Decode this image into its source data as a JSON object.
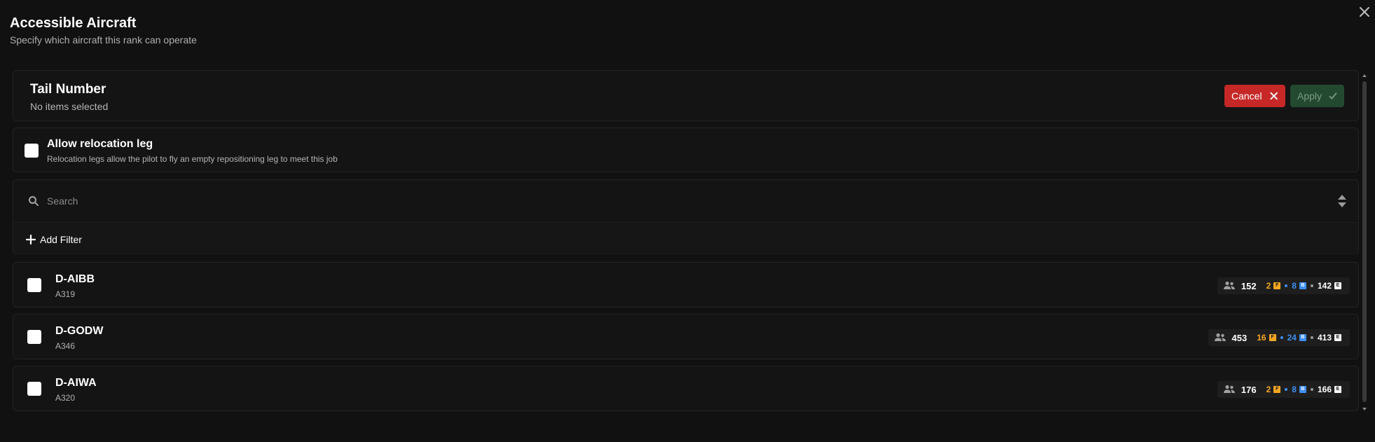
{
  "dialog": {
    "title": "Accessible Aircraft",
    "subtitle": "Specify which aircraft this rank can operate"
  },
  "tail_panel": {
    "title": "Tail Number",
    "selection_status": "No items selected",
    "cancel_label": "Cancel",
    "apply_label": "Apply"
  },
  "relocation": {
    "checked": false,
    "label": "Allow relocation leg",
    "description": "Relocation legs allow the pilot to fly an empty repositioning leg to meet this job"
  },
  "search": {
    "placeholder": "Search",
    "value": "",
    "add_filter_label": "Add Filter"
  },
  "class_codes": {
    "first": "F",
    "business": "B",
    "economy": "E"
  },
  "colors": {
    "first": "#f5a623",
    "business": "#3d8ef0",
    "economy": "#ffffff",
    "cancel": "#c62828",
    "apply": "#234a30"
  },
  "aircraft": [
    {
      "tail": "D-AIBB",
      "type": "A319",
      "checked": false,
      "total": "152",
      "first": "2",
      "business": "8",
      "economy": "142"
    },
    {
      "tail": "D-GODW",
      "type": "A346",
      "checked": false,
      "total": "453",
      "first": "16",
      "business": "24",
      "economy": "413"
    },
    {
      "tail": "D-AIWA",
      "type": "A320",
      "checked": false,
      "total": "176",
      "first": "2",
      "business": "8",
      "economy": "166"
    }
  ]
}
